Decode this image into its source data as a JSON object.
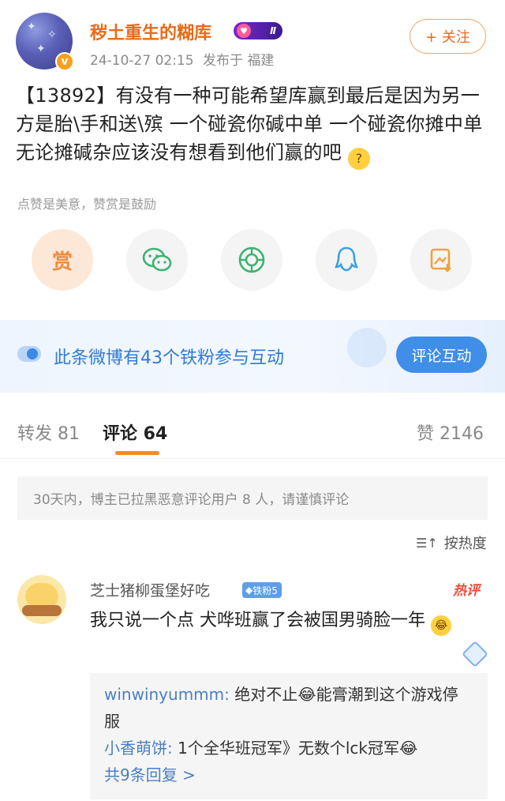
{
  "post": {
    "username": "秽土重生的糊库",
    "level_badge": "Ⅱ",
    "timestamp": "24-10-27 02:15",
    "location": "发布于 福建",
    "follow_label": "+ 关注",
    "verified_mark": "v",
    "text": "【13892】有没有一种可能希望库赢到最后是因为另一方是胎\\手和送\\殡 一个碰瓷你碱中单 一个碰瓷你摊中单 无论摊碱杂应该没有想看到他们赢的吧",
    "emoji_glyph": "?",
    "reward_hint": "点赞是美意，赞赏是鼓励",
    "reward_char": "赏"
  },
  "share_buttons": [
    {
      "icon": "reward-icon"
    },
    {
      "icon": "wechat-icon"
    },
    {
      "icon": "moments-icon"
    },
    {
      "icon": "qq-icon"
    },
    {
      "icon": "save-image-icon"
    }
  ],
  "fans_bar": {
    "text": "此条微博有43个铁粉参与互动",
    "button": "评论互动"
  },
  "tabs": {
    "repost": "转发 81",
    "comments": "评论 64",
    "likes": "赞 2146"
  },
  "notice": "30天内，博主已拉黑恶意评论用户 8 人，请谨慎评论",
  "sort_label": "按热度",
  "comment": {
    "username": "芝士猪柳蛋堡好吃",
    "fan_badge": "铁粉5",
    "hot_tag": "热评",
    "text": "我只说一个点 犬哗班赢了会被国男骑脸一年",
    "replies": [
      {
        "name": "winwinyummm:",
        "text": " 绝对不止😂能膏潮到这个游戏停服"
      },
      {
        "name": "小香萌饼:",
        "text": " 1个全华班冠军》无数个lck冠军😂"
      }
    ],
    "more_replies": "共9条回复 >"
  },
  "colors": {
    "accent_orange": "#e86b1a",
    "fans_blue": "#3f8ee8",
    "link_blue": "#4a7fc1",
    "hot_red": "#ef4b3a"
  }
}
